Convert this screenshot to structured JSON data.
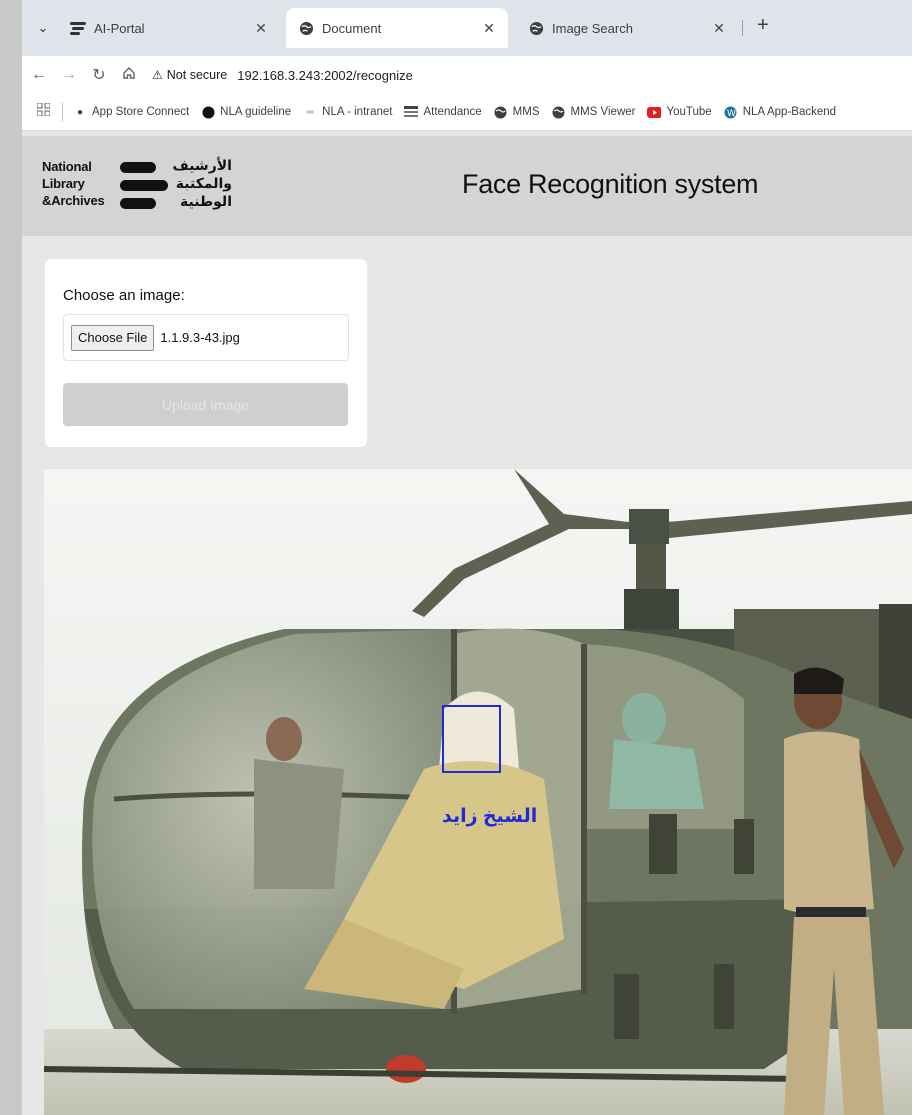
{
  "browser": {
    "tabs": [
      {
        "title": "AI-Portal",
        "icon": "ai-portal-icon",
        "active": false
      },
      {
        "title": "Document",
        "icon": "globe-icon",
        "active": true
      },
      {
        "title": "Image Search",
        "icon": "globe-icon",
        "active": false
      }
    ],
    "security_label": "Not secure",
    "url": "192.168.3.243:2002/recognize",
    "bookmarks": [
      {
        "label": "App Store Connect",
        "icon": "apple-icon"
      },
      {
        "label": "NLA guideline",
        "icon": "nla-circle-icon"
      },
      {
        "label": "NLA - intranet",
        "icon": "nla-dash-icon"
      },
      {
        "label": "Attendance",
        "icon": "attendance-icon"
      },
      {
        "label": "MMS",
        "icon": "globe-icon"
      },
      {
        "label": "MMS Viewer",
        "icon": "globe-icon"
      },
      {
        "label": "YouTube",
        "icon": "youtube-icon"
      },
      {
        "label": "NLA App-Backend",
        "icon": "wordpress-icon"
      }
    ]
  },
  "header": {
    "logo_en": [
      "National",
      "Library",
      "&Archives"
    ],
    "logo_ar": [
      "الأرشيف",
      "والمكتبة",
      "الوطنية"
    ],
    "title": "Face Recognition system"
  },
  "upload": {
    "label": "Choose an image:",
    "file_button": "Choose File",
    "file_name": "1.1.9.3-43.jpg",
    "submit_label": "Upload Image"
  },
  "result": {
    "face_name": "الشيخ زايد"
  },
  "colors": {
    "header_bg": "#d3d4d6",
    "face_box": "#1f2bd6",
    "upload_disabled": "#cfcfcf"
  }
}
